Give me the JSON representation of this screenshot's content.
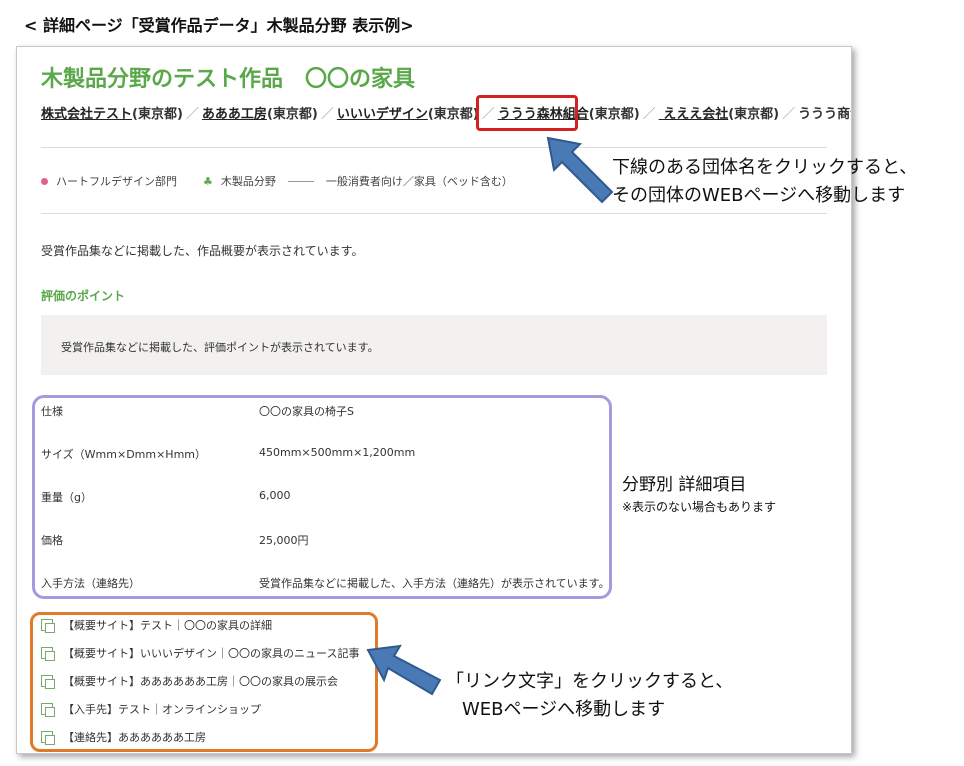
{
  "caption": "< 詳細ページ「受賞作品データ」木製品分野 表示例>",
  "page": {
    "title": "木製品分野のテスト作品　〇〇の家具",
    "orgs": [
      {
        "name": "株式会社テスト",
        "pref": "(東京都)"
      },
      {
        "name": "あああ工房",
        "pref": "(東京都)"
      },
      {
        "name": "いいいデザイン",
        "pref": "(東京都)"
      },
      {
        "name": "ううう森林組合",
        "pref": "(東京都)"
      },
      {
        "name": " えええ会社",
        "pref": "(東京都)"
      },
      {
        "name": "ううう商会",
        "pref": ""
      }
    ],
    "org_separator": "／",
    "tags": {
      "department": "ハートフルデザイン部門",
      "field": "木製品分野",
      "category": "一般消費者向け／家具（ベッド含む）"
    },
    "summary": "受賞作品集などに掲載した、作品概要が表示されています。",
    "points_heading": "評価のポイント",
    "points_text": "受賞作品集などに掲載した、評価ポイントが表示されています。",
    "spec": [
      {
        "label": "仕様",
        "value": "〇〇の家具の椅子S"
      },
      {
        "label": "サイズ（Wmm×Dmm×Hmm）",
        "value": "450mm×500mm×1,200mm"
      },
      {
        "label": "重量（g）",
        "value": "6,000"
      },
      {
        "label": "価格",
        "value": "25,000円"
      },
      {
        "label": "入手方法（連絡先）",
        "value": "受賞作品集などに掲載した、入手方法（連絡先）が表示されています。"
      }
    ],
    "links": [
      "【概要サイト】テスト｜〇〇の家具の詳細",
      "【概要サイト】いいいデザイン｜〇〇の家具のニュース記事",
      "【概要サイト】ああああああ工房｜〇〇の家具の展示会",
      "【入手先】テスト｜オンラインショップ",
      "【連絡先】ああああああ工房"
    ]
  },
  "annotations": {
    "org_note_line1": "下線のある団体名をクリックすると、",
    "org_note_line2": "その団体のWEBページへ移動します",
    "spec_note": "分野別 詳細項目",
    "spec_note_sub": "※表示のない場合もあります",
    "link_note_line1": "「リンク文字」をクリックすると、",
    "link_note_line2": "WEBページへ移動します"
  },
  "colors": {
    "title_green": "#5aa84a",
    "highlight_red": "#d32020",
    "highlight_purple": "#a59ae0",
    "highlight_orange": "#e07a28",
    "arrow_blue": "#4a7ab5"
  }
}
